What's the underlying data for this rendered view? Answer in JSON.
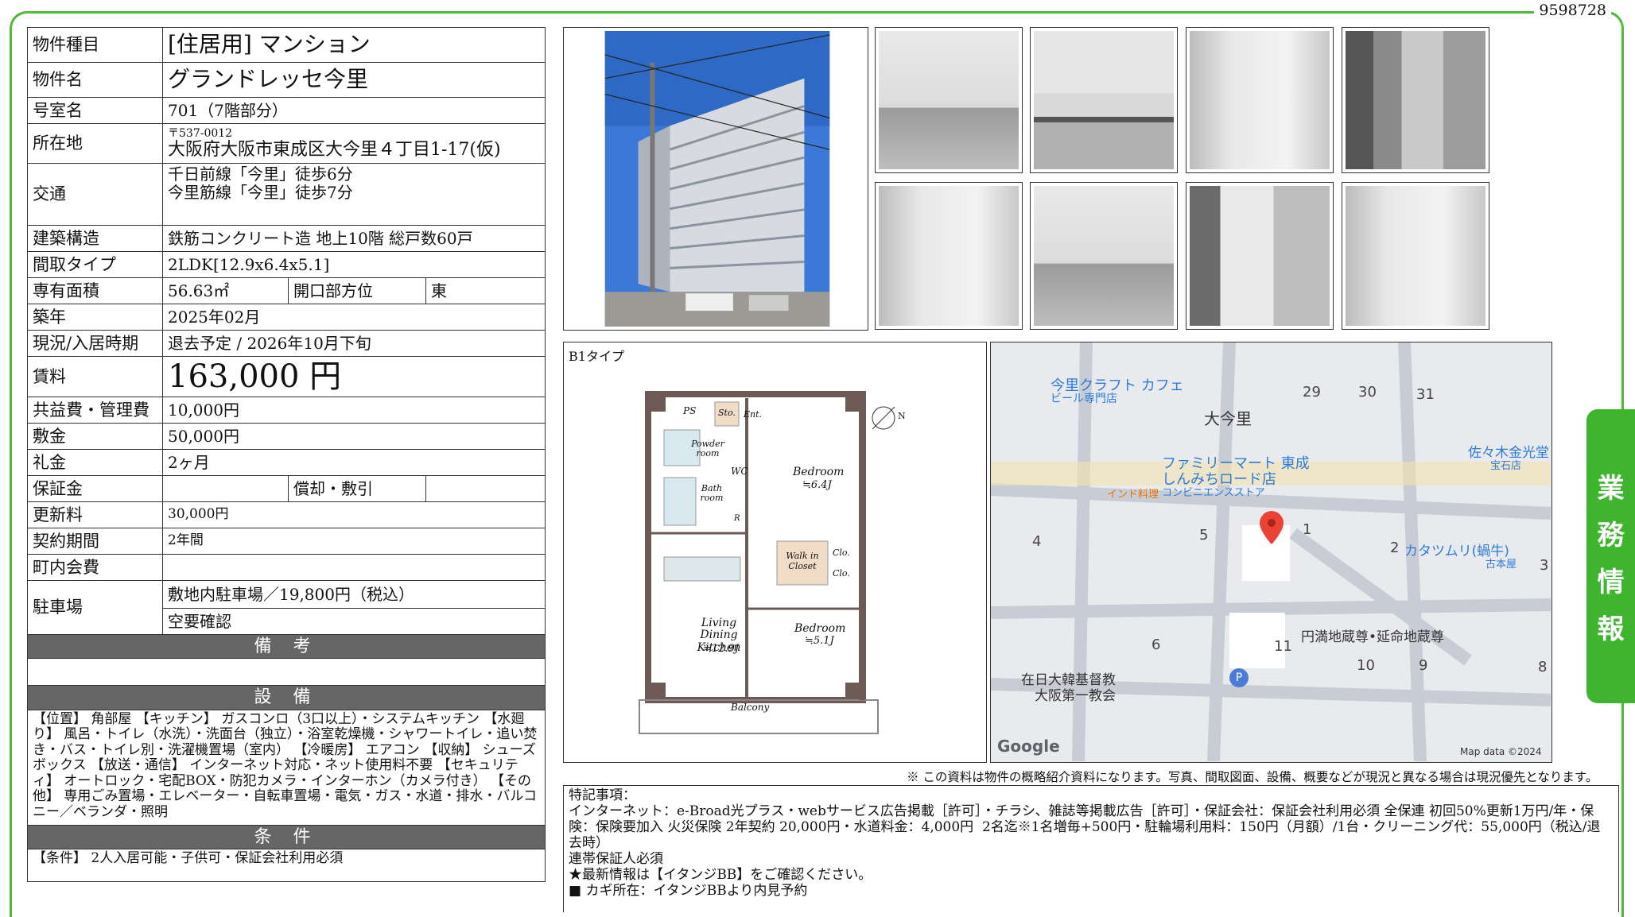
{
  "doc_id": "9598728",
  "property": {
    "rows": [
      {
        "label": "物件種目",
        "value": "[住居用]  マンション"
      },
      {
        "label": "物件名",
        "value": "グランドレッセ今里"
      },
      {
        "label": "号室名",
        "value": "701（7階部分）"
      },
      {
        "label": "所在地",
        "postal": "〒537-0012",
        "value": "大阪府大阪市東成区大今里４丁目1-17(仮)"
      },
      {
        "label": "交通",
        "line1": "千日前線「今里」徒歩6分",
        "line2": "今里筋線「今里」徒歩7分"
      },
      {
        "label": "建築構造",
        "value": "鉄筋コンクリート造  地上10階  総戸数60戸"
      },
      {
        "label": "間取タイプ",
        "value": "2LDK[12.9x6.4x5.1]"
      },
      {
        "label": "専有面積",
        "value": "56.63㎡",
        "label2": "開口部方位",
        "value2": "東"
      },
      {
        "label": "築年",
        "value": "2025年02月"
      },
      {
        "label": "現況/入居時期",
        "value": "退去予定  /  2026年10月下旬"
      },
      {
        "label": "賃料",
        "value": "163,000  円"
      },
      {
        "label": "共益費・管理費",
        "value": "10,000円"
      },
      {
        "label": "敷金",
        "value": "50,000円"
      },
      {
        "label": "礼金",
        "value": "2ヶ月"
      },
      {
        "label": "保証金",
        "value": "",
        "label2": "償却・敷引",
        "value2": ""
      },
      {
        "label": "更新料",
        "value": "30,000円"
      },
      {
        "label": "契約期間",
        "value": "2年間"
      },
      {
        "label": "町内会費",
        "value": ""
      },
      {
        "label": "駐車場",
        "line1": "敷地内駐車場／19,800円（税込）",
        "line2": "空要確認"
      }
    ],
    "remarks_title": "備 考",
    "remarks": "",
    "equipment_title": "設 備",
    "equipment": "【位置】 角部屋 【キッチン】 ガスコンロ（3口以上）・システムキッチン 【水廻り】 風呂・トイレ（水洗）・洗面台（独立）・浴室乾燥機・シャワートイレ・追い焚き・バス・トイレ別・洗濯機置場（室内） 【冷暖房】 エアコン 【収納】 シューズボックス 【放送・通信】 インターネット対応・ネット使用料不要 【セキュリティ】 オートロック・宅配BOX・防犯カメラ・インターホン（カメラ付き） 【その他】 専用ごみ置場・エレベーター・自転車置場・電気・ガス・水道・排水・バルコニー／ベランダ・照明",
    "conditions_title": "条 件",
    "conditions": "【条件】 2人入居可能・子供可・保証会社利用必須"
  },
  "floorplan": {
    "type_label": "B1タイプ",
    "rooms": [
      "PS",
      "Sto.",
      "Ent.",
      "Powder room",
      "WC",
      "Bath room",
      "R",
      "Bedroom",
      "≒6.4J",
      "Walk in Closet",
      "Clo.",
      "Clo.",
      "Living Dining Kitchen",
      "≒12.9J",
      "Bedroom",
      "≒5.1J",
      "Balcony",
      "N"
    ]
  },
  "map": {
    "labels": [
      "今里クラフト カフェ",
      "ビール専門店",
      "大今里",
      "ファミリーマート 東成",
      "しんみちロード店",
      "コンビニエンスストア",
      "インド料理",
      "佐々木金光堂",
      "宝石店",
      "カタツムリ(蝸牛)",
      "古本屋",
      "円満地蔵尊•延命地蔵尊",
      "在日大韓基督教",
      "大阪第一教会",
      "Google",
      "Map data ©2024"
    ],
    "numbers": [
      "29",
      "30",
      "31",
      "4",
      "5",
      "1",
      "2",
      "3",
      "6",
      "11",
      "10",
      "9",
      "8"
    ]
  },
  "disclaimer": "※ この資料は物件の概略紹介資料になります。写真、間取図面、設備、概要などが現況と異なる場合は現況優先となります。",
  "special_notes": "特記事項：\nインターネット：e-Broad光プラス・webサービス広告掲載［許可］・チラシ、雑誌等掲載広告［許可］・保証会社：保証会社利用必須 全保連 初回50%更新1万円/年・保険：保険要加入 火災保険 2年契約 20,000円・水道料金：4,000円  2名迄※1名増毎+500円・駐輪場利用料：150円（月額）/1台・クリーニング代：55,000円（税込/退去時）\n連帯保証人必須\n★最新情報は【イタンジBB】をご確認ください。\n■ カギ所在：イタンジBBより内見予約",
  "side_tab": [
    "業",
    "務",
    "情",
    "報"
  ],
  "colors": {
    "accent": "#3fb52f",
    "band": "#666666"
  }
}
